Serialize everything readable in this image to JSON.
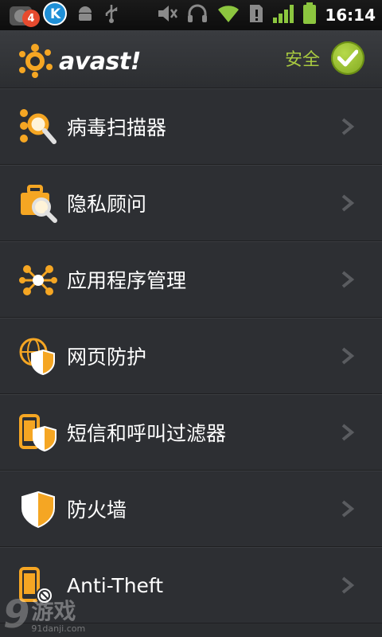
{
  "status_bar": {
    "notification_count": "4",
    "time": "16:14",
    "icons": [
      "avast-notification-icon",
      "k-app-icon",
      "android-debug-icon",
      "usb-icon",
      "mute-icon",
      "headphones-icon",
      "wifi-icon",
      "alert-icon",
      "signal-icon",
      "battery-icon"
    ]
  },
  "header": {
    "logo_text": "avast!",
    "status_text": "安全"
  },
  "menu": {
    "items": [
      {
        "label": "病毒扫描器",
        "icon": "virus-scanner-icon"
      },
      {
        "label": "隐私顾问",
        "icon": "privacy-advisor-icon"
      },
      {
        "label": "应用程序管理",
        "icon": "app-manager-icon"
      },
      {
        "label": "网页防护",
        "icon": "web-shield-icon"
      },
      {
        "label": "短信和呼叫过滤器",
        "icon": "sms-call-filter-icon"
      },
      {
        "label": "防火墙",
        "icon": "firewall-icon"
      },
      {
        "label": "Anti-Theft",
        "icon": "anti-theft-icon"
      }
    ]
  },
  "watermark": {
    "brand": "9",
    "brand2": "游戏",
    "site": "91danji.com"
  },
  "colors": {
    "accent_orange": "#f5a623",
    "safe_green": "#a8c940",
    "background": "#2d2f33"
  }
}
